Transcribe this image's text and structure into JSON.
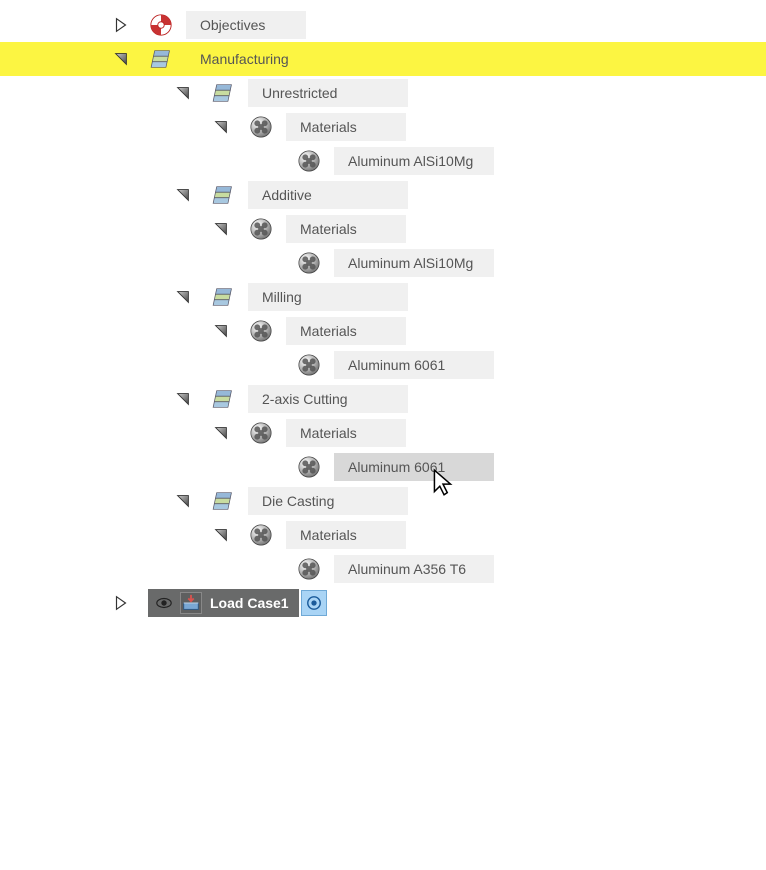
{
  "tree": {
    "objectives": {
      "label": "Objectives"
    },
    "manufacturing": {
      "label": "Manufacturing",
      "children": [
        {
          "label": "Unrestricted",
          "materials_label": "Materials",
          "materials": [
            "Aluminum AlSi10Mg"
          ]
        },
        {
          "label": "Additive",
          "materials_label": "Materials",
          "materials": [
            "Aluminum AlSi10Mg"
          ]
        },
        {
          "label": "Milling",
          "materials_label": "Materials",
          "materials": [
            "Aluminum 6061"
          ]
        },
        {
          "label": "2-axis Cutting",
          "materials_label": "Materials",
          "materials": [
            "Aluminum 6061"
          ],
          "hovered": true
        },
        {
          "label": "Die Casting",
          "materials_label": "Materials",
          "materials": [
            "Aluminum A356 T6"
          ]
        }
      ]
    },
    "loadcase": {
      "label": "Load Case1"
    }
  },
  "icons": {
    "objectives": "objectives-target-icon",
    "manufacturing": "layers-icon",
    "method": "layers-icon",
    "materials": "sphere-icon",
    "material": "sphere-icon"
  }
}
